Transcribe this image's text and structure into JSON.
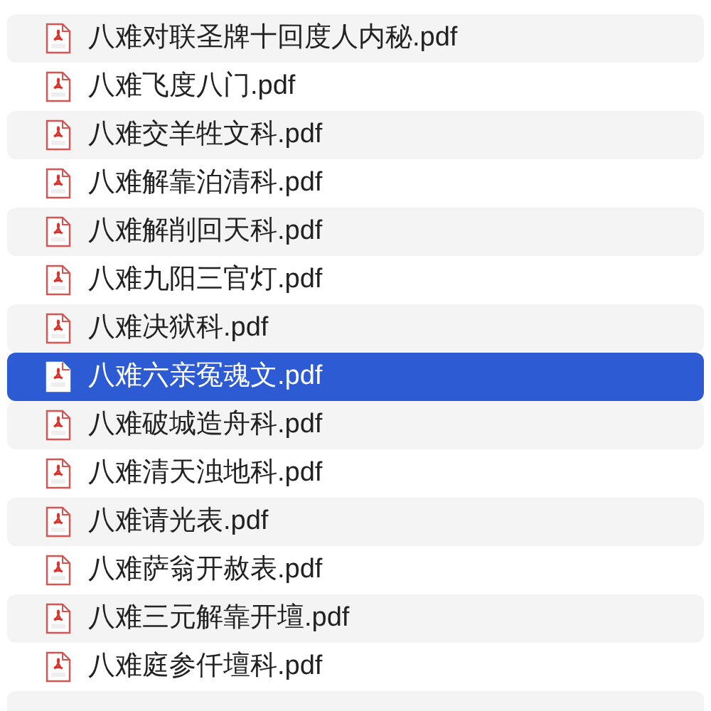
{
  "files": [
    {
      "name": "八难对联圣牌十回度人内秘.pdf",
      "selected": false
    },
    {
      "name": "八难飞度八门.pdf",
      "selected": false
    },
    {
      "name": "八难交羊牲文科.pdf",
      "selected": false
    },
    {
      "name": "八难解靠泊清科.pdf",
      "selected": false
    },
    {
      "name": "八难解削回天科.pdf",
      "selected": false
    },
    {
      "name": "八难九阳三官灯.pdf",
      "selected": false
    },
    {
      "name": "八难决狱科.pdf",
      "selected": false
    },
    {
      "name": "八难六亲冤魂文.pdf",
      "selected": true
    },
    {
      "name": "八难破城造舟科.pdf",
      "selected": false
    },
    {
      "name": "八难清天浊地科.pdf",
      "selected": false
    },
    {
      "name": "八难请光表.pdf",
      "selected": false
    },
    {
      "name": "八难萨翁开赦表.pdf",
      "selected": false
    },
    {
      "name": "八难三元解靠开壇.pdf",
      "selected": false
    },
    {
      "name": "八难庭参仟壇科.pdf",
      "selected": false
    }
  ]
}
